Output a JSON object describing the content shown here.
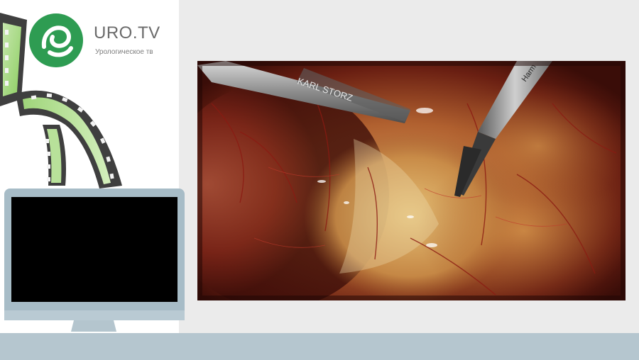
{
  "brand": {
    "name": "URO.TV",
    "tagline": "Урологическое тв",
    "logo_icon": "uro-tv-logo-icon",
    "accent_color": "#2e9c52"
  },
  "video": {
    "content": "laparoscopic-surgery-frame",
    "instrument_text_left": "KARL STORZ",
    "instrument_text_right": "Harm"
  },
  "monitor": {
    "screen_color": "#000000",
    "frame_color": "#a7bcc7"
  },
  "colors": {
    "background": "#ebebeb",
    "bottom_bar": "#b5c6cf",
    "film_green": "#8ecf63"
  }
}
